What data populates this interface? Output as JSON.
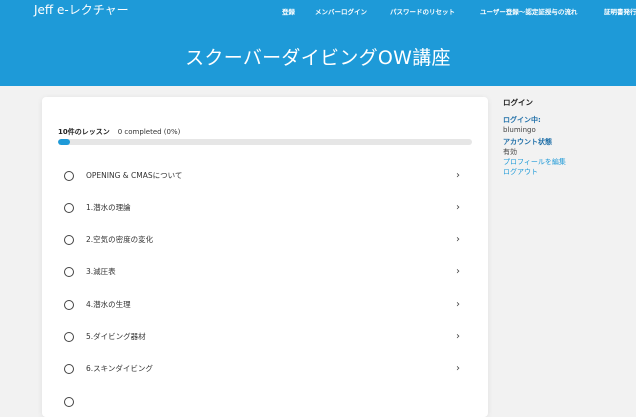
{
  "header": {
    "brand": "Jeff e-レクチャー",
    "nav": [
      "登録",
      "メンバーログイン",
      "パスワードのリセット",
      "ユーザー登録～認定証授与の流れ",
      "証明書発行"
    ],
    "page_title": "スクーバーダイビングOW講座",
    "colors": {
      "accent": "#1e9ad8"
    }
  },
  "course": {
    "lesson_count_label": "10件のレッスン",
    "completed_label": "0 completed (0%)",
    "progress_percent": 0,
    "lessons": [
      "OPENING & CMASについて",
      "1.潜水の理論",
      "2.空気の密度の変化",
      "3.減圧表",
      "4.潜水の生理",
      "5.ダイビング器材",
      "6.スキンダイビング"
    ]
  },
  "sidebar": {
    "title": "ログイン",
    "logged_in_label": "ログイン中:",
    "username": "blumingo",
    "account_status_label": "アカウント状態",
    "account_status_value": "有効",
    "edit_profile_link": "プロフィールを編集",
    "logout_link": "ログアウト"
  }
}
